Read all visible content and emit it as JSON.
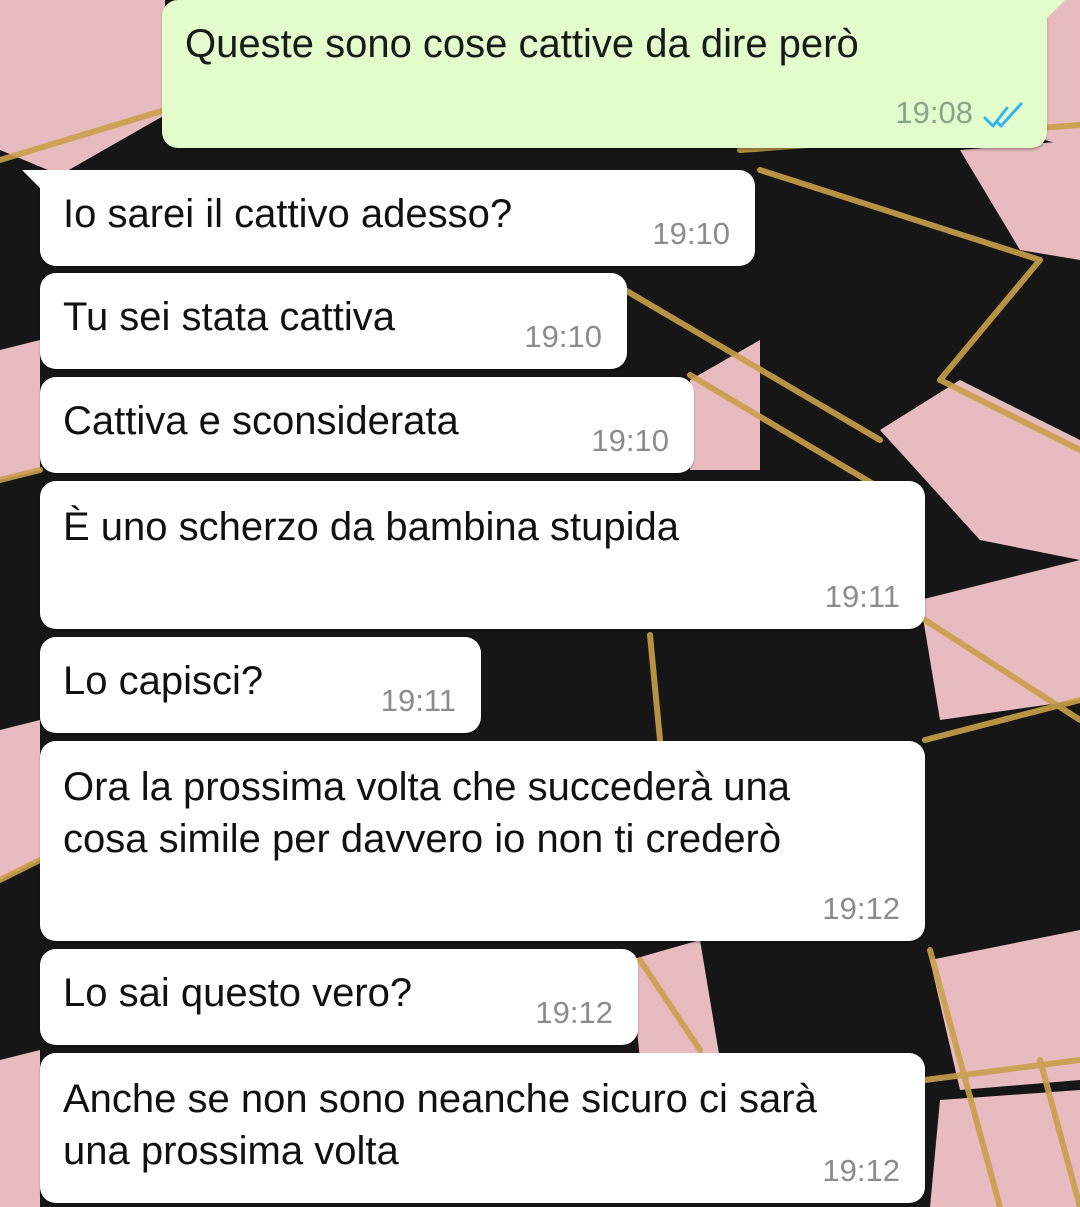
{
  "messages": [
    {
      "direction": "outgoing",
      "text": "Queste sono cose cattive da dire però",
      "time": "19:08",
      "status_icon": "double-check-read-icon"
    },
    {
      "direction": "incoming",
      "text": "Io sarei il cattivo adesso?",
      "time": "19:10"
    },
    {
      "direction": "incoming",
      "text": "Tu sei stata cattiva",
      "time": "19:10"
    },
    {
      "direction": "incoming",
      "text": "Cattiva e sconsiderata",
      "time": "19:10"
    },
    {
      "direction": "incoming",
      "text": "È uno scherzo da bambina stupida",
      "time": "19:11"
    },
    {
      "direction": "incoming",
      "text": "Lo capisci?",
      "time": "19:11"
    },
    {
      "direction": "incoming",
      "text": "Ora la prossima volta che succederà una\ncosa simile per davvero io non ti crederò",
      "time": "19:12"
    },
    {
      "direction": "incoming",
      "text": "Lo sai questo vero?",
      "time": "19:12"
    },
    {
      "direction": "incoming",
      "text": "Anche se non sono neanche sicuro ci sarà\nuna prossima volta",
      "time": "19:12"
    }
  ],
  "colors": {
    "outgoing_bubble": "#e2fdcb",
    "incoming_bubble": "#ffffff",
    "read_ticks": "#34b7f1",
    "wallpaper_pink": "#e8bcc0",
    "wallpaper_black": "#151515",
    "wallpaper_gold": "#c9a04a"
  }
}
